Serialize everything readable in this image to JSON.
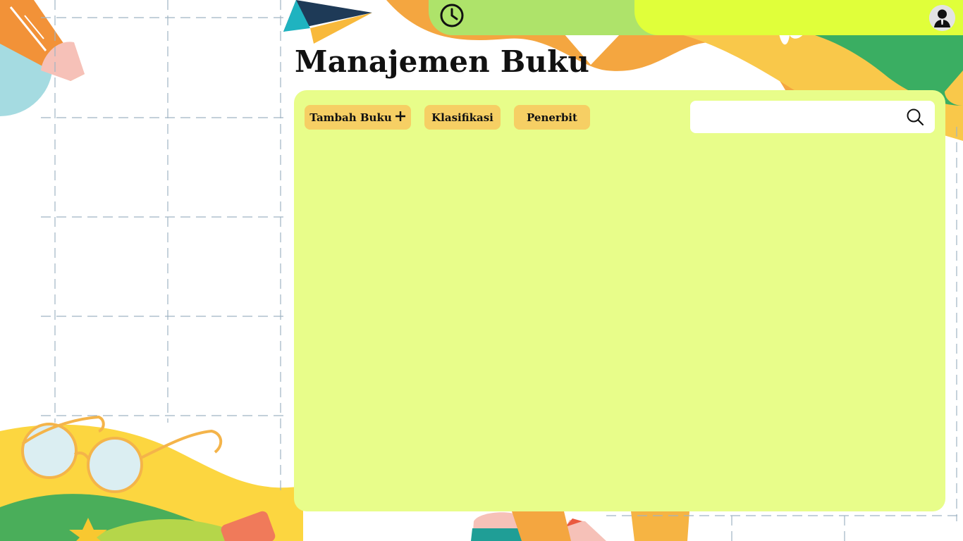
{
  "page": {
    "title": "Manajemen Buku"
  },
  "header": {
    "clock_icon": "clock-icon",
    "avatar_icon": "user-avatar-icon"
  },
  "toolbar": {
    "add_book_label": "Tambah Buku",
    "add_icon": "plus-icon",
    "classification_label": "Klasifikasi",
    "publisher_label": "Penerbit"
  },
  "search": {
    "value": "",
    "placeholder": "",
    "icon": "search-icon"
  },
  "colors": {
    "panel": "#e8fd8a",
    "button": "#f6cf64",
    "topbar_green": "#aee36a",
    "topbar_lime": "#e0ff3a"
  }
}
